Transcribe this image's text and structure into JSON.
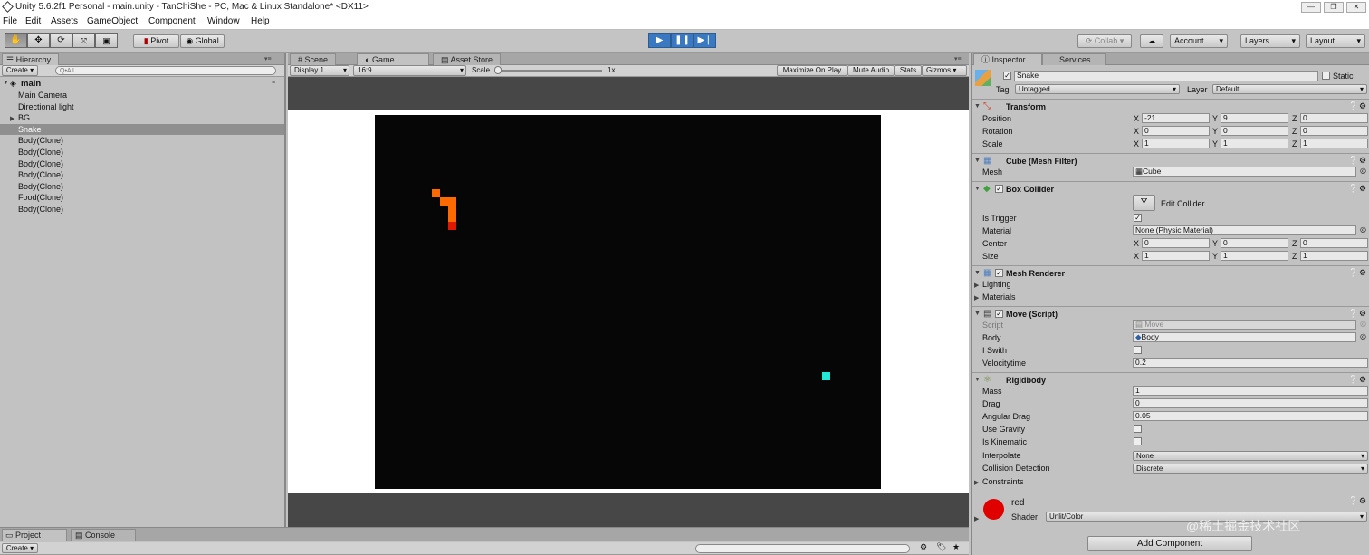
{
  "window": {
    "title": "Unity 5.6.2f1 Personal - main.unity - TanChiShe - PC, Mac & Linux Standalone* <DX11>",
    "controls": [
      "—",
      "❐",
      "✕"
    ]
  },
  "menu": [
    "File",
    "Edit",
    "Assets",
    "GameObject",
    "Component",
    "Window",
    "Help"
  ],
  "toolbar": {
    "pivot": "Pivot",
    "global": "Global",
    "collab": "Collab",
    "account": "Account",
    "layers": "Layers",
    "layout": "Layout"
  },
  "hierarchy": {
    "tab": "Hierarchy",
    "create": "Create",
    "search_placeholder": "Q•All",
    "scene": "main",
    "items": [
      {
        "label": "Main Camera"
      },
      {
        "label": "Directional light"
      },
      {
        "label": "BG"
      },
      {
        "label": "Snake"
      },
      {
        "label": "Body(Clone)"
      },
      {
        "label": "Body(Clone)"
      },
      {
        "label": "Body(Clone)"
      },
      {
        "label": "Body(Clone)"
      },
      {
        "label": "Body(Clone)"
      },
      {
        "label": "Food(Clone)"
      },
      {
        "label": "Body(Clone)"
      }
    ]
  },
  "center": {
    "tabs": [
      "Scene",
      "Game",
      "Asset Store"
    ],
    "display": "Display 1",
    "aspect": "16:9",
    "scale_label": "Scale",
    "scale_value": "1x",
    "buttons": [
      "Maximize On Play",
      "Mute Audio",
      "Stats",
      "Gizmos"
    ]
  },
  "inspector": {
    "tabs": [
      "Inspector",
      "Services"
    ],
    "object_name": "Snake",
    "static_label": "Static",
    "tag_label": "Tag",
    "tag_value": "Untagged",
    "layer_label": "Layer",
    "layer_value": "Default",
    "transform": {
      "title": "Transform",
      "position_label": "Position",
      "rotation_label": "Rotation",
      "scale_label": "Scale",
      "position": [
        "-21",
        "9",
        "0"
      ],
      "rotation": [
        "0",
        "0",
        "0"
      ],
      "scale": [
        "1",
        "1",
        "1"
      ]
    },
    "mesh_filter": {
      "title": "Cube (Mesh Filter)",
      "mesh_label": "Mesh",
      "mesh_value": "Cube"
    },
    "box_collider": {
      "title": "Box Collider",
      "edit_collider": "Edit Collider",
      "is_trigger_label": "Is Trigger",
      "material_label": "Material",
      "material_value": "None (Physic Material)",
      "center_label": "Center",
      "size_label": "Size",
      "center": [
        "0",
        "0",
        "0"
      ],
      "size": [
        "1",
        "1",
        "1"
      ]
    },
    "mesh_renderer": {
      "title": "Mesh Renderer",
      "lighting": "Lighting",
      "materials": "Materials"
    },
    "move_script": {
      "title": "Move (Script)",
      "script_label": "Script",
      "script_value": "Move",
      "body_label": "Body",
      "body_value": "Body",
      "iswith_label": "I Swith",
      "velocity_label": "Velocitytime",
      "velocity_value": "0.2"
    },
    "rigidbody": {
      "title": "Rigidbody",
      "mass_label": "Mass",
      "mass": "1",
      "drag_label": "Drag",
      "drag": "0",
      "angular_label": "Angular Drag",
      "angular": "0.05",
      "gravity_label": "Use Gravity",
      "kinematic_label": "Is Kinematic",
      "interpolate_label": "Interpolate",
      "interpolate": "None",
      "collision_label": "Collision Detection",
      "collision": "Discrete",
      "constraints_label": "Constraints"
    },
    "material": {
      "name": "red",
      "shader_label": "Shader",
      "shader_value": "Unlit/Color",
      "color": "#e00000"
    },
    "add_component": "Add Component"
  },
  "bottom": {
    "tabs": [
      "Project",
      "Console"
    ],
    "create": "Create"
  },
  "watermark": "@稀土掘金技术社区",
  "colors": {
    "snake": "#ff6a00",
    "snake_head": "#e01800",
    "food": "#1de9d6",
    "game_bg": "#060606",
    "play_blue": "#3b78c2"
  }
}
